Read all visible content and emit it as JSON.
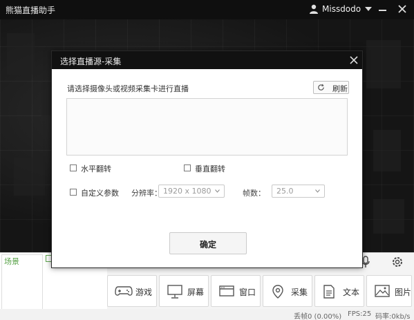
{
  "window": {
    "title": "熊猫直播助手",
    "user": "Missdodo"
  },
  "dialog": {
    "title": "选择直播源-采集",
    "prompt": "请选择摄像头或视频采集卡进行直播",
    "refresh_label": "刷新",
    "flip_horizontal_label": "水平翻转",
    "flip_vertical_label": "垂直翻转",
    "custom_params_label": "自定义参数",
    "resolution_label": "分辨率：",
    "resolution_value": "1920 x 1080",
    "fps_label": "帧数：",
    "fps_value": "25.0",
    "ok_label": "确定"
  },
  "scene_panel": {
    "label": "场景"
  },
  "sources": [
    {
      "label": "游戏",
      "icon": "gamepad-icon"
    },
    {
      "label": "屏幕",
      "icon": "monitor-icon"
    },
    {
      "label": "窗口",
      "icon": "window-icon"
    },
    {
      "label": "采集",
      "icon": "location-pin-icon"
    },
    {
      "label": "文本",
      "icon": "document-icon"
    },
    {
      "label": "图片",
      "icon": "image-icon"
    }
  ],
  "status": {
    "dropped": "丢帧0 (0.00%)",
    "fps": "FPS:25",
    "bitrate": "码率:0kb/s"
  },
  "colors": {
    "accent_green": "#5aa34a",
    "titlebar": "#111111"
  }
}
